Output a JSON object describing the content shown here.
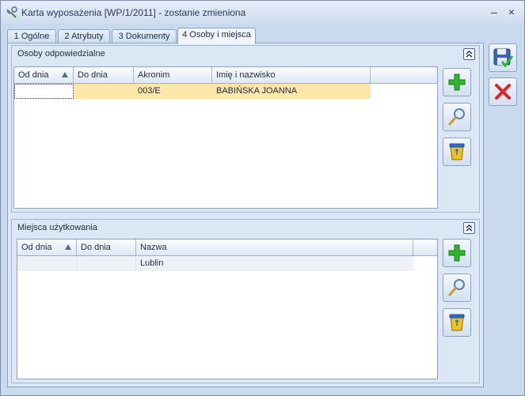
{
  "window": {
    "title": "Karta wyposażenia [WP/1/2011] - zostanie zmieniona",
    "minimize_glyph": "–",
    "close_glyph": "×"
  },
  "tabs": [
    {
      "label": "1 Ogólne",
      "active": false
    },
    {
      "label": "2 Atrybuty",
      "active": false
    },
    {
      "label": "3 Dokumenty",
      "active": false
    },
    {
      "label": "4 Osoby i miejsca",
      "active": true
    }
  ],
  "persons": {
    "title": "Osoby odpowiedzialne",
    "columns": [
      "Od dnia",
      "Do dnia",
      "Akronim",
      "Imię i nazwisko"
    ],
    "rows": [
      {
        "od_dnia": "",
        "do_dnia": "",
        "akronim": "003/E",
        "imie_nazwisko": "BABIŃSKA JOANNA"
      }
    ],
    "buttons": [
      "add-icon",
      "search-icon",
      "delete-icon"
    ]
  },
  "places": {
    "title": "Miejsca użytkowania",
    "columns": [
      "Od dnia",
      "Do dnia",
      "Nazwa"
    ],
    "rows": [
      {
        "od_dnia": "",
        "do_dnia": "",
        "nazwa": "Lublin"
      }
    ],
    "buttons": [
      "add-icon",
      "search-icon",
      "delete-icon"
    ]
  },
  "actions": [
    "save-icon",
    "cancel-icon"
  ],
  "colors": {
    "selected_row": "#fde7a8",
    "add_green": "#2fb52b",
    "cancel_red": "#d8262a"
  }
}
